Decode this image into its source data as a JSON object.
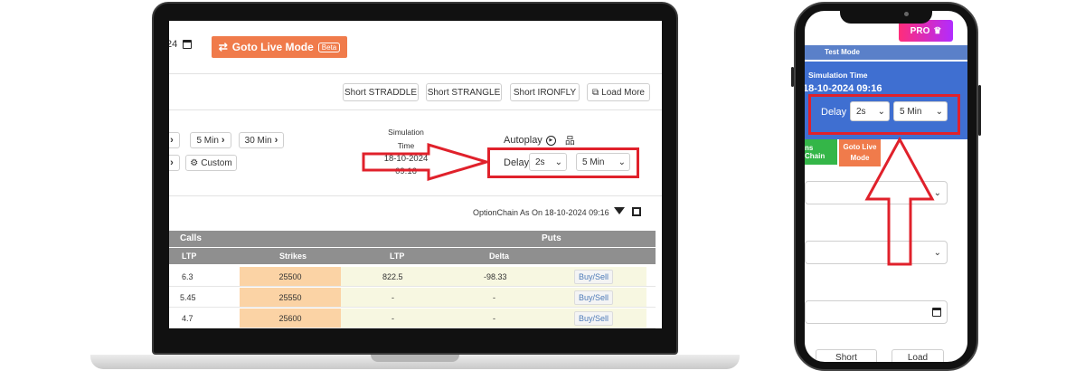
{
  "laptop": {
    "date_fragment": "24",
    "live_button": {
      "label": "Goto Live Mode",
      "badge": "Beta"
    },
    "strategy_buttons": [
      "Short STRADDLE",
      "Short STRANGLE",
      "Short IRONFLY"
    ],
    "load_more": "Load More",
    "interval_buttons": [
      "5 Min",
      "30 Min"
    ],
    "custom_button": "Custom",
    "simulation": {
      "label_line1": "Simulation",
      "label_line2": "Time",
      "date": "18-10-2024",
      "time": "09:16"
    },
    "autoplay_label": "Autoplay",
    "delay": {
      "label": "Delay",
      "speed": "2s",
      "interval": "5 Min"
    },
    "option_chain_label": "OptionChain As On 18-10-2024 09:16",
    "table": {
      "group_headers": {
        "calls": "Calls",
        "puts": "Puts"
      },
      "columns": [
        "LTP",
        "Strikes",
        "LTP",
        "Delta"
      ],
      "rows": [
        {
          "call_ltp": "6.3",
          "strike": "25500",
          "put_ltp": "822.5",
          "delta": "-98.33",
          "action": "Buy/Sell"
        },
        {
          "call_ltp": "5.45",
          "strike": "25550",
          "put_ltp": "-",
          "delta": "-",
          "action": "Buy/Sell"
        },
        {
          "call_ltp": "4.7",
          "strike": "25600",
          "put_ltp": "-",
          "delta": "-",
          "action": "Buy/Sell"
        }
      ]
    }
  },
  "phone": {
    "pro_badge": "PRO",
    "test_mode": "Test Mode",
    "simulation_time_label": "Simulation Time",
    "simulation_datetime": "18-10-2024 09:16",
    "delay": {
      "label": "Delay",
      "speed": "2s",
      "interval": "5 Min"
    },
    "chain_chip": "ns Chain",
    "live_chip_line1": "Goto Live",
    "live_chip_line2": "Mode",
    "bottom_buttons": [
      "Short",
      "Load"
    ]
  },
  "colors": {
    "highlight_red": "#e0212b",
    "live_orange": "#f07b4b",
    "table_header_gray": "#8f8f8f",
    "strike_orange": "#fbd3a5",
    "phone_blue": "#3f6fd1",
    "chain_green": "#34b648"
  }
}
